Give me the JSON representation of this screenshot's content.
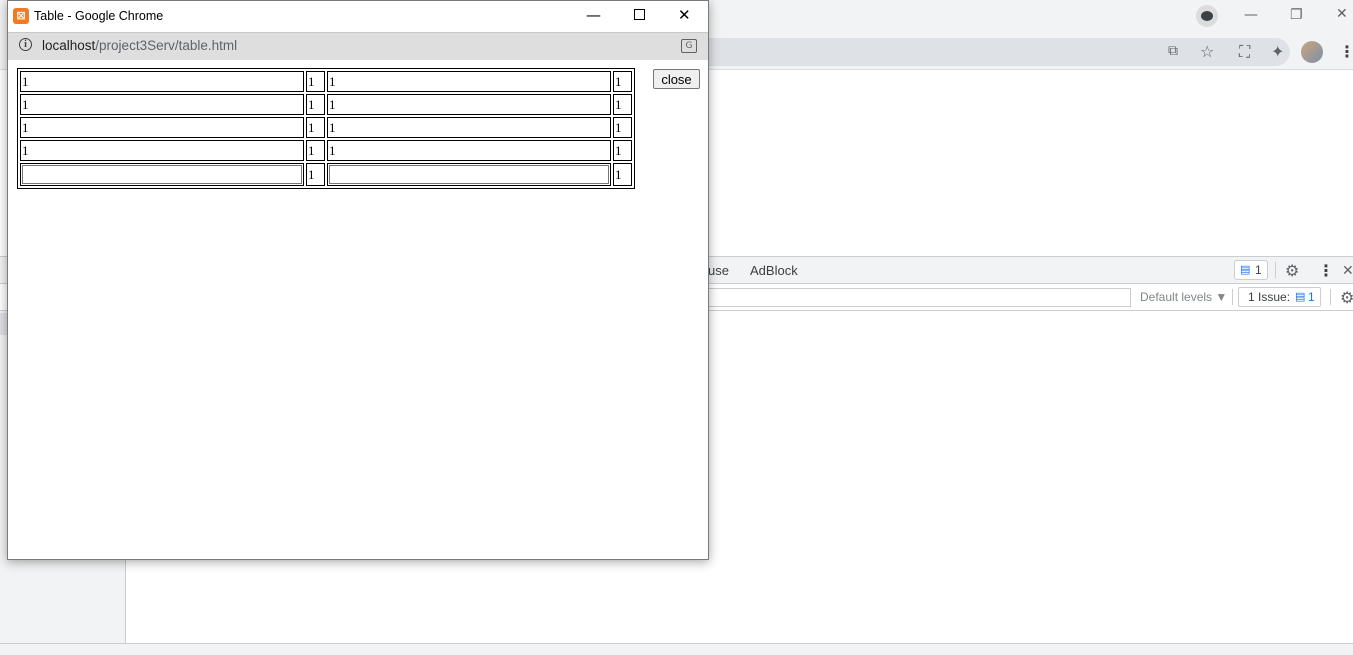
{
  "background": {
    "window_controls": {
      "minimize": "—",
      "restore": "❐",
      "close": "✕"
    },
    "toolbar_icons": [
      "translate-icon",
      "star-icon",
      "screenshot-icon",
      "extensions-icon",
      "profile-avatar",
      "menu-icon"
    ],
    "devtools": {
      "tab_partial": "use",
      "tab_adblock": "AdBlock",
      "issue_badge_count": "1",
      "filter_levels": "Default levels ▼",
      "issues_button_label": "1 Issue:",
      "issues_button_count": "1"
    }
  },
  "popup": {
    "title": "Table - Google Chrome",
    "url_host": "localhost",
    "url_path": "/project3Serv/table.html",
    "close_button": "close",
    "rows": [
      {
        "c1": "1",
        "c2": "1",
        "c3": "1",
        "c4": "1"
      },
      {
        "c1": "1",
        "c2": "1",
        "c3": "1",
        "c4": "1"
      },
      {
        "c1": "1",
        "c2": "1",
        "c3": "1",
        "c4": "1"
      },
      {
        "c1": "1",
        "c2": "1",
        "c3": "1",
        "c4": "1"
      }
    ],
    "input_row": {
      "input1_value": "",
      "c2": "1",
      "input2_value": "",
      "c4": "1"
    }
  },
  "colors": {
    "chrome_frame": "#f1f3f4",
    "popup_urlbar": "#dedede",
    "app_icon": "#f57a1f",
    "accent_blue": "#1a73e8"
  }
}
